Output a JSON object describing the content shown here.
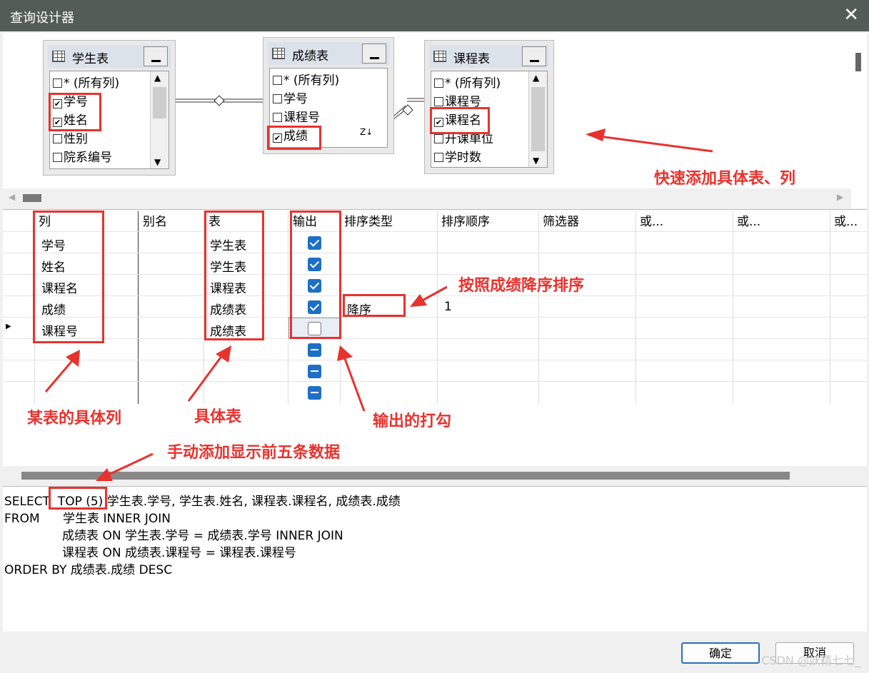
{
  "window": {
    "title": "查询设计器",
    "close": "✕"
  },
  "diagram": {
    "tables": [
      {
        "name": "学生表",
        "columns": [
          {
            "label": "* (所有列)",
            "checked": false
          },
          {
            "label": "学号",
            "checked": true
          },
          {
            "label": "姓名",
            "checked": true
          },
          {
            "label": "性别",
            "checked": false
          },
          {
            "label": "院系编号",
            "checked": false
          }
        ]
      },
      {
        "name": "成绩表",
        "columns": [
          {
            "label": "* (所有列)",
            "checked": false
          },
          {
            "label": "学号",
            "checked": false
          },
          {
            "label": "课程号",
            "checked": false
          },
          {
            "label": "成绩",
            "checked": true
          }
        ],
        "sort_icon": "Z↓"
      },
      {
        "name": "课程表",
        "columns": [
          {
            "label": "* (所有列)",
            "checked": false
          },
          {
            "label": "课程号",
            "checked": false
          },
          {
            "label": "课程名",
            "checked": true
          },
          {
            "label": "开课单位",
            "checked": false
          },
          {
            "label": "学时数",
            "checked": false
          }
        ]
      }
    ]
  },
  "annotations": {
    "quick_add": "快速添加具体表、列",
    "sort_desc": "按照成绩降序排序",
    "column": "某表的具体列",
    "table": "具体表",
    "output": "输出的打勾",
    "top5": "手动添加显示前五条数据"
  },
  "grid": {
    "headers": [
      "列",
      "别名",
      "表",
      "输出",
      "排序类型",
      "排序顺序",
      "筛选器",
      "或...",
      "或...",
      "或..."
    ],
    "rows": [
      {
        "column": "学号",
        "table": "学生表",
        "output": "checked",
        "sort_type": "",
        "sort_order": ""
      },
      {
        "column": "姓名",
        "table": "学生表",
        "output": "checked",
        "sort_type": "",
        "sort_order": ""
      },
      {
        "column": "课程名",
        "table": "课程表",
        "output": "checked",
        "sort_type": "",
        "sort_order": ""
      },
      {
        "column": "成绩",
        "table": "成绩表",
        "output": "checked",
        "sort_type": "降序",
        "sort_order": "1"
      },
      {
        "column": "课程号",
        "table": "成绩表",
        "output": "unchecked",
        "sort_type": "",
        "sort_order": ""
      }
    ]
  },
  "sql": {
    "lines": [
      "SELECT  TOP (5) 学生表.学号, 学生表.姓名, 课程表.课程名, 成绩表.成绩",
      "FROM      学生表 INNER JOIN",
      "               成绩表 ON 学生表.学号 = 成绩表.学号 INNER JOIN",
      "               课程表 ON 成绩表.课程号 = 课程表.课程号",
      "ORDER BY 成绩表.成绩 DESC"
    ]
  },
  "buttons": {
    "ok": "确定",
    "cancel": "取消"
  },
  "watermark": "CSDN @妖精七七_",
  "colors": {
    "annotation": "#e8322e",
    "checkbox": "#1d6fc6",
    "titlebar": "#535d56"
  }
}
